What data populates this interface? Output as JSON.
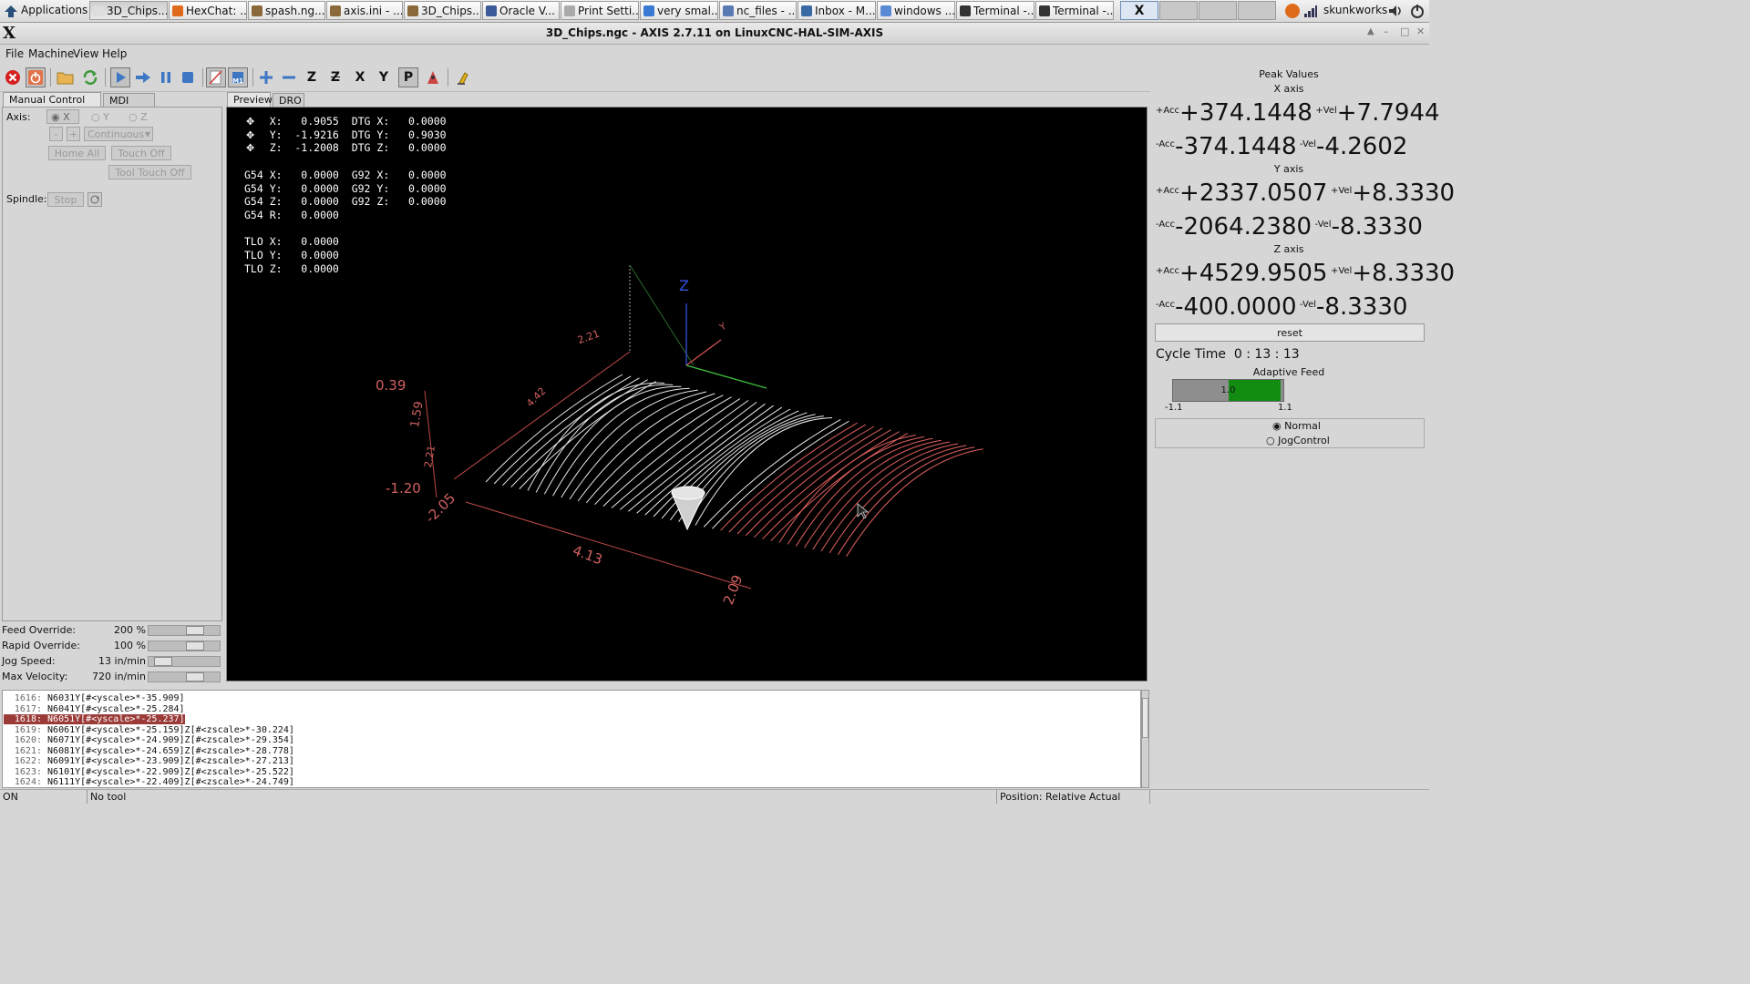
{
  "taskbar": {
    "apps_label": "Applications",
    "tasks": [
      "3D_Chips...",
      "HexChat: ...",
      "spash.ng...",
      "axis.ini - ...",
      "3D_Chips...",
      "Oracle V...",
      "Print Setti...",
      "very smal...",
      "nc_files - ...",
      "Inbox - M...",
      "windows ...",
      "Terminal -...",
      "Terminal -..."
    ],
    "user": "skunkworks"
  },
  "window": {
    "logo": "X",
    "title": "3D_Chips.ngc - AXIS 2.7.11 on LinuxCNC-HAL-SIM-AXIS"
  },
  "menu": [
    "File",
    "Machine",
    "View",
    "Help"
  ],
  "toolbar": {
    "icons": [
      "estop-icon",
      "machine-power-icon",
      "open-file-icon",
      "reload-icon",
      "run-icon",
      "step-icon",
      "pause-icon",
      "stop-icon",
      "block-delete-icon",
      "optional-stop-icon",
      "zoom-in-icon",
      "zoom-out-icon",
      "view-z-icon",
      "view-z2-icon",
      "view-x-icon",
      "view-y-icon",
      "view-p-icon",
      "rotate-view-icon",
      "clear-plot-icon"
    ],
    "view_letters": {
      "z": "Z",
      "z2": "Z",
      "x": "X",
      "y": "Y",
      "p": "P"
    }
  },
  "left_tabs": [
    "Manual Control [F3]",
    "MDI [F5]"
  ],
  "manual": {
    "axis_label": "Axis:",
    "axis_options": [
      "X",
      "Y",
      "Z"
    ],
    "minus": "-",
    "plus": "+",
    "jog_mode": "Continuous",
    "home_all": "Home All",
    "touch_off": "Touch Off",
    "tool_touch_off": "Tool Touch Off",
    "spindle_label": "Spindle:",
    "spindle_stop": "Stop"
  },
  "overrides": [
    {
      "label": "Feed Override:",
      "value": "200 %",
      "level": 0.7
    },
    {
      "label": "Rapid Override:",
      "value": "100 %",
      "level": 0.7
    },
    {
      "label": "Jog Speed:",
      "value": "13 in/min",
      "level": 0.1
    },
    {
      "label": "Max Velocity:",
      "value": "720 in/min",
      "level": 0.7
    }
  ],
  "preview_tabs": [
    "Preview",
    "DRO"
  ],
  "dro_text": "    X:   0.9055  DTG X:   0.0000\n    Y:  -1.9216  DTG Y:   0.9030\n    Z:  -1.2008  DTG Z:   0.0000\n\nG54 X:   0.0000  G92 X:   0.0000\nG54 Y:   0.0000  G92 Y:   0.0000\nG54 Z:   0.0000  G92 Z:   0.0000\nG54 R:   0.0000\n\nTLO X:   0.0000\nTLO Y:   0.0000\nTLO Z:   0.0000",
  "dims": {
    "top": "2.21",
    "depth": "4.42",
    "height_top": "0.39",
    "height_mid": "1.59",
    "height_low": "2.21",
    "height_bottom": "-1.20",
    "left": "-2.05",
    "width": "4.13",
    "right": "2.09",
    "axis_z": "Z",
    "axis_y": "Y"
  },
  "peak": {
    "title": "Peak Values",
    "axes": [
      {
        "name": "X axis",
        "acc_pos": "+374.1448",
        "vel_pos": "+7.7944",
        "acc_neg": "-374.1448",
        "vel_neg": "-4.2602"
      },
      {
        "name": "Y axis",
        "acc_pos": "+2337.0507",
        "vel_pos": "+8.3330",
        "acc_neg": "-2064.2380",
        "vel_neg": "-8.3330"
      },
      {
        "name": "Z axis",
        "acc_pos": "+4529.9505",
        "vel_pos": "+8.3330",
        "acc_neg": "-400.0000",
        "vel_neg": "-8.3330"
      }
    ],
    "acc_pos_label": "+Acc",
    "vel_pos_label": "+Vel",
    "acc_neg_label": "-Acc",
    "vel_neg_label": "-Vel",
    "reset": "reset",
    "cycle_label": "Cycle Time",
    "cycle_value": "0 : 13 : 13",
    "adaptive_label": "Adaptive Feed",
    "adaptive_value": "1.0",
    "adaptive_level": 0.5,
    "adaptive_min": "-1.1",
    "adaptive_max": "1.1",
    "mode_normal": "Normal",
    "mode_jog": "JogControl"
  },
  "code_lines": [
    {
      "num": "1616:",
      "text": "N6031Y[#<yscale>*-35.909]"
    },
    {
      "num": "1617:",
      "text": "N6041Y[#<yscale>*-25.284]"
    },
    {
      "num": "1618:",
      "text": "N6051Y[#<yscale>*-25.237]"
    },
    {
      "num": "1619:",
      "text": "N6061Y[#<yscale>*-25.159]Z[#<zscale>*-30.224]"
    },
    {
      "num": "1620:",
      "text": "N6071Y[#<yscale>*-24.909]Z[#<zscale>*-29.354]"
    },
    {
      "num": "1621:",
      "text": "N6081Y[#<yscale>*-24.659]Z[#<zscale>*-28.778]"
    },
    {
      "num": "1622:",
      "text": "N6091Y[#<yscale>*-23.909]Z[#<zscale>*-27.213]"
    },
    {
      "num": "1623:",
      "text": "N6101Y[#<yscale>*-22.909]Z[#<zscale>*-25.522]"
    },
    {
      "num": "1624:",
      "text": "N6111Y[#<yscale>*-22.409]Z[#<zscale>*-24.749]"
    }
  ],
  "status": {
    "machine": "ON",
    "tool": "No tool",
    "position": "Position: Relative Actual"
  }
}
